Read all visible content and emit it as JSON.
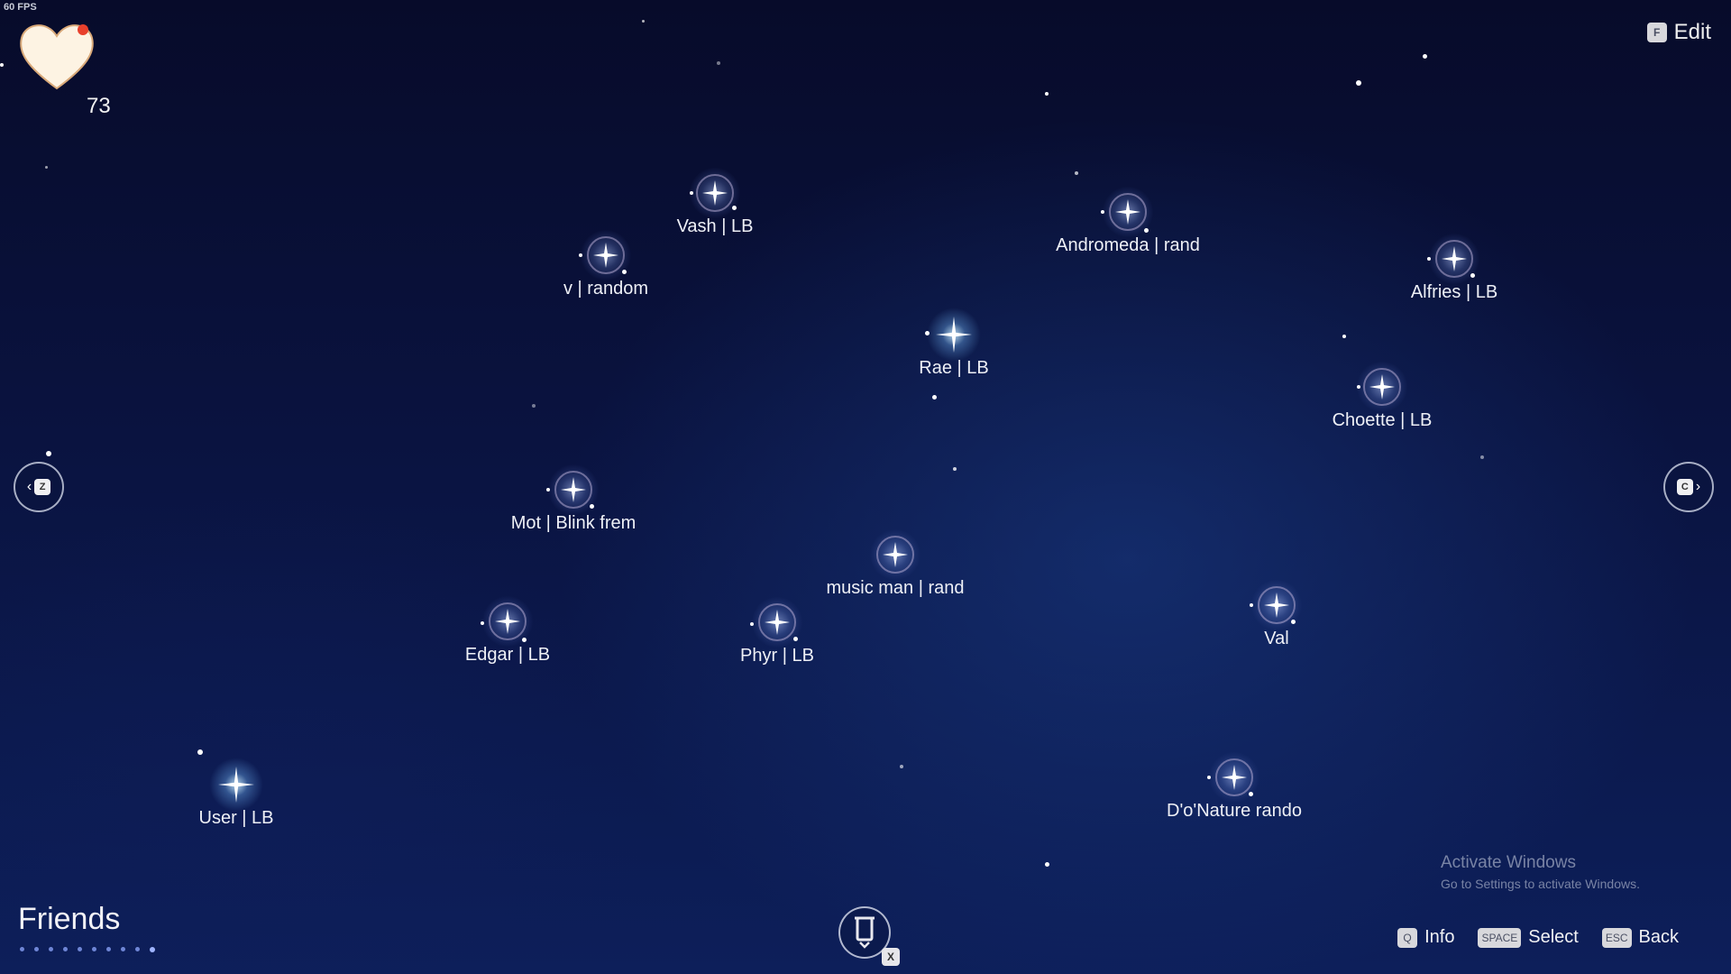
{
  "fps": "60 FPS",
  "hearts": {
    "count": "73"
  },
  "edit": {
    "key": "F",
    "label": "Edit"
  },
  "nav": {
    "prev_key": "Z",
    "next_key": "C"
  },
  "friends": [
    {
      "name": "Vash | LB",
      "style": "ringed"
    },
    {
      "name": "v | random",
      "style": "ringed"
    },
    {
      "name": "Andromeda | rand",
      "style": "ringed"
    },
    {
      "name": "Alfries | LB",
      "style": "ringed"
    },
    {
      "name": "Rae | LB",
      "style": "bright"
    },
    {
      "name": "Choette | LB",
      "style": "ringed"
    },
    {
      "name": "Mot | Blink frem",
      "style": "ringed"
    },
    {
      "name": "music man | rand",
      "style": "ringed"
    },
    {
      "name": "Edgar | LB",
      "style": "ringed"
    },
    {
      "name": "Phyr | LB",
      "style": "ringed"
    },
    {
      "name": "Val",
      "style": "ringed"
    },
    {
      "name": "D'o'Nature rando",
      "style": "ringed"
    },
    {
      "name": "User | LB",
      "style": "bright"
    }
  ],
  "section": {
    "title": "Friends"
  },
  "bottom": {
    "x_key": "X"
  },
  "watermark": {
    "title": "Activate Windows",
    "subtitle": "Go to Settings to activate Windows."
  },
  "hints": [
    {
      "key": "Q",
      "label": "Info"
    },
    {
      "key": "SPACE",
      "label": "Select"
    },
    {
      "key": "ESC",
      "label": "Back"
    }
  ],
  "colors": {
    "sky_top": "#070b2a",
    "sky_bottom": "#0d1f5a",
    "heart": "#fdf3e3",
    "heart_badge": "#e8402c"
  }
}
